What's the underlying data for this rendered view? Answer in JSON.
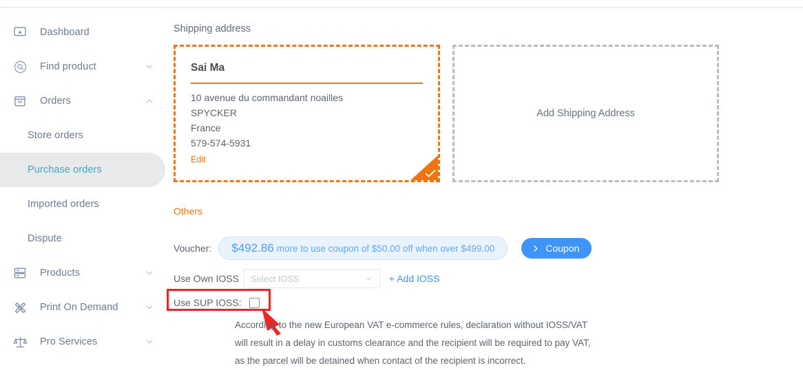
{
  "sidebar": {
    "items": [
      {
        "label": "Dashboard",
        "icon": "dashboard-icon",
        "expandable": false,
        "chevron": ""
      },
      {
        "label": "Find product",
        "icon": "search-circle-icon",
        "expandable": true,
        "chevron": "chevron-down-icon"
      },
      {
        "label": "Orders",
        "icon": "bag-icon",
        "expandable": true,
        "chevron": "chevron-up-icon"
      },
      {
        "label": "Products",
        "icon": "server-stack-icon",
        "expandable": true,
        "chevron": "chevron-down-icon"
      },
      {
        "label": "Print On Demand",
        "icon": "pen-ruler-icon",
        "expandable": true,
        "chevron": "chevron-down-icon"
      },
      {
        "label": "Pro Services",
        "icon": "scales-icon",
        "expandable": true,
        "chevron": "chevron-down-icon"
      }
    ],
    "orders_subitems": [
      {
        "label": "Store orders",
        "active": false
      },
      {
        "label": "Purchase orders",
        "active": true
      },
      {
        "label": "Imported orders",
        "active": false
      },
      {
        "label": "Dispute",
        "active": false
      }
    ]
  },
  "main": {
    "shipping_title": "Shipping address",
    "selected_address": {
      "name": "Sai Ma",
      "line1": "10 avenue du commandant noailles",
      "line2": "SPYCKER",
      "line3": "France",
      "phone": "579-574-5931",
      "edit_label": "Edit",
      "selected": true
    },
    "add_address_label": "Add Shipping Address",
    "others_label": "Others",
    "voucher": {
      "label": "Voucher:",
      "amount": "$492.86",
      "message": "more to use coupon of $50.00 off when over $499.00",
      "coupon_button": "Coupon"
    },
    "ioss": {
      "own_label": "Use Own IOSS",
      "select_placeholder": "Select IOSS",
      "select_value": "",
      "add_label": "+ Add IOSS",
      "sup_label": "Use SUP IOSS:",
      "sup_checked": false
    },
    "vat_note": [
      "According to the new European VAT e-commerce rules, declaration without IOSS/VAT",
      "will result in a delay in customs clearance and the recipient will be required to pay VAT,",
      "as the parcel will be detained when contact of the recipient is incorrect."
    ]
  },
  "colors": {
    "accent_orange": "#f2740b",
    "accent_blue": "#3f94f7",
    "annotation_red": "#fd1b1b",
    "sidebar_active_bg": "#e7e9eb",
    "sidebar_active_text": "#45a6c4",
    "text_muted": "#6b7c93"
  }
}
